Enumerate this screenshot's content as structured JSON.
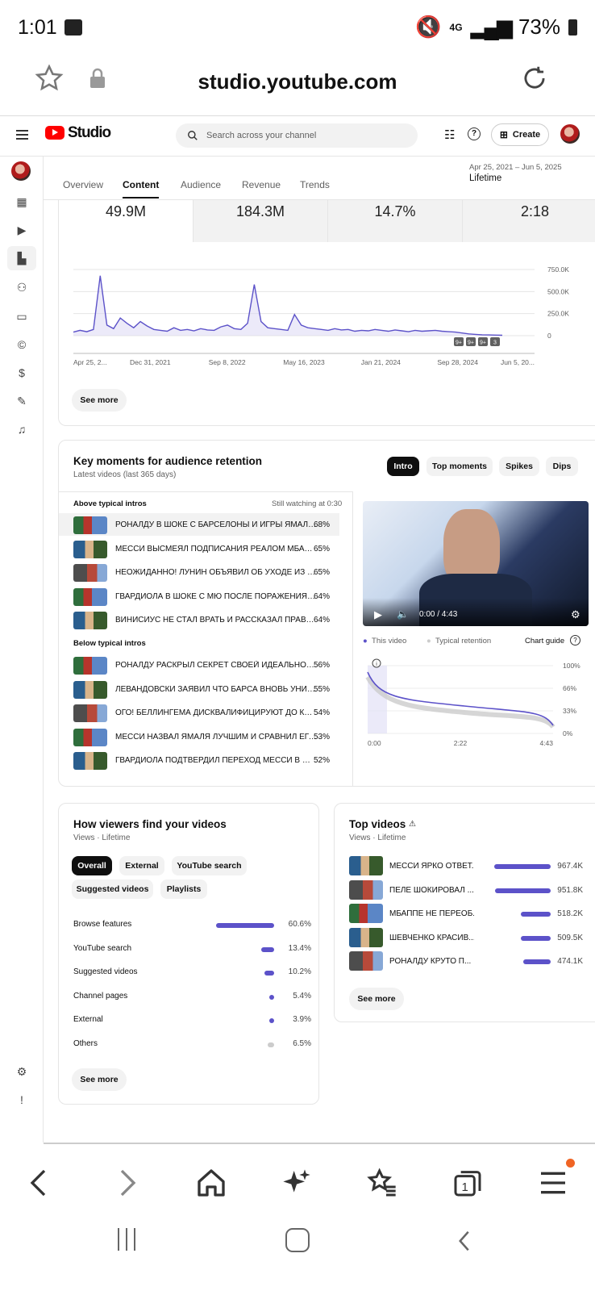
{
  "status": {
    "time": "1:01",
    "network": "4G",
    "battery": "73%"
  },
  "browser": {
    "url": "studio.youtube.com"
  },
  "studio": {
    "logo": "Studio",
    "search_placeholder": "Search across your channel",
    "create_label": "Create"
  },
  "tabs": [
    "Overview",
    "Content",
    "Audience",
    "Revenue",
    "Trends"
  ],
  "date_range": {
    "range": "Apr 25, 2021 – Jun 5, 2025",
    "label": "Lifetime"
  },
  "metrics": [
    "49.9M",
    "184.3M",
    "14.7%",
    "2:18"
  ],
  "chart_data": {
    "type": "line",
    "x_ticks": [
      "Apr 25, 2...",
      "Dec 31, 2021",
      "Sep 8, 2022",
      "May 16, 2023",
      "Jan 21, 2024",
      "Sep 28, 2024",
      "Jun 5, 20..."
    ],
    "y_ticks": [
      "750.0K",
      "500.0K",
      "250.0K",
      "0"
    ],
    "ylim": [
      0,
      750000
    ],
    "series": [
      {
        "values": [
          40000,
          60000,
          45000,
          70000,
          680000,
          120000,
          80000,
          200000,
          140000,
          90000,
          160000,
          110000,
          70000,
          60000,
          50000,
          90000,
          60000,
          70000,
          55000,
          80000,
          65000,
          60000,
          100000,
          120000,
          80000,
          70000,
          140000,
          580000,
          160000,
          90000,
          80000,
          70000,
          60000,
          240000,
          120000,
          90000,
          80000,
          70000,
          60000,
          80000,
          65000,
          70000,
          50000,
          60000,
          55000,
          70000,
          60000,
          50000,
          65000,
          55000,
          45000,
          60000,
          50000,
          55000,
          60000,
          50000,
          45000,
          40000,
          30000,
          20000,
          15000,
          10000,
          8000,
          6000,
          5000
        ]
      }
    ],
    "markers": [
      "9+",
      "9+",
      "9+",
      "3"
    ],
    "see_more": "See more"
  },
  "retention": {
    "title": "Key moments for audience retention",
    "subtitle": "Latest videos (last 365 days)",
    "chips": [
      "Intro",
      "Top moments",
      "Spikes",
      "Dips"
    ],
    "above_label": "Above typical intros",
    "still_watching": "Still watching at 0:30",
    "above": [
      {
        "title": "РОНАЛДУ В ШОКЕ С БАРСЕЛОНЫ И ИГРЫ ЯМАЛЯ В ...",
        "pct": "68%"
      },
      {
        "title": "МЕССИ ВЫСМЕЯЛ ПОДПИСАНИЯ РЕАЛОМ МБАППЕ ...",
        "pct": "65%"
      },
      {
        "title": "НЕОЖИДАННО! ЛУНИН ОБЪЯВИЛ ОБ УХОДЕ ИЗ РЕА...",
        "pct": "65%"
      },
      {
        "title": "ГВАРДИОЛА В ШОКЕ С МЮ ПОСЛЕ ПОРАЖЕНИЯ И РА...",
        "pct": "64%"
      },
      {
        "title": "ВИНИСИУС НЕ СТАЛ ВРАТЬ И РАССКАЗАЛ ПРАВДУ О...",
        "pct": "64%"
      }
    ],
    "below_label": "Below typical intros",
    "below": [
      {
        "title": "РОНАЛДУ РАСКРЫЛ СЕКРЕТ СВОЕЙ ИДЕАЛЬНОЙ Ф...",
        "pct": "56%"
      },
      {
        "title": "ЛЕВАНДОВСКИ ЗАЯВИЛ ЧТО БАРСА ВНОВЬ УНИЧТО...",
        "pct": "55%"
      },
      {
        "title": "ОГО! БЕЛЛИНГЕМА ДИСКВАЛИФИЦИРУЮТ ДО КОНЦ...",
        "pct": "54%"
      },
      {
        "title": "МЕССИ НАЗВАЛ ЯМАЛЯ ЛУЧШИМ И СРАВНИЛ ЕГО С ...",
        "pct": "53%"
      },
      {
        "title": "ГВАРДИОЛА ПОДТВЕРДИЛ ПЕРЕХОД МЕССИ В МАН ...",
        "pct": "52%"
      }
    ],
    "player_time": "0:00 / 4:43",
    "legend_this": "This video",
    "legend_typical": "Typical retention",
    "chart_guide": "Chart guide",
    "y_ticks": [
      "100%",
      "66%",
      "33%",
      "0%"
    ],
    "x_ticks": [
      "0:00",
      "2:22",
      "4:43"
    ]
  },
  "sources": {
    "title": "How viewers find your videos",
    "subtitle": "Views · Lifetime",
    "chips": [
      "Overall",
      "External",
      "YouTube search",
      "Suggested videos",
      "Playlists"
    ],
    "rows": [
      {
        "label": "Browse features",
        "pct": "60.6%",
        "value": 60.6
      },
      {
        "label": "YouTube search",
        "pct": "13.4%",
        "value": 13.4
      },
      {
        "label": "Suggested videos",
        "pct": "10.2%",
        "value": 10.2
      },
      {
        "label": "Channel pages",
        "pct": "5.4%",
        "value": 5.4
      },
      {
        "label": "External",
        "pct": "3.9%",
        "value": 3.9
      },
      {
        "label": "Others",
        "pct": "6.5%",
        "value": 6.5
      }
    ],
    "see_more": "See more"
  },
  "top_videos": {
    "title": "Top videos",
    "subtitle": "Views · Lifetime",
    "rows": [
      {
        "title": "МЕССИ ЯРКО ОТВЕТ...",
        "views": "967.4K",
        "value": 967.4
      },
      {
        "title": "ПЕЛЕ ШОКИРОВАЛ ...",
        "views": "951.8K",
        "value": 951.8
      },
      {
        "title": "МБАППЕ НЕ ПЕРЕОБ...",
        "views": "518.2K",
        "value": 518.2
      },
      {
        "title": "ШЕВЧЕНКО КРАСИВ...",
        "views": "509.5K",
        "value": 509.5
      },
      {
        "title": "РОНАЛДУ КРУТО П...",
        "views": "474.1K",
        "value": 474.1
      }
    ],
    "see_more": "See more"
  },
  "colors": {
    "accent": "#5c52c9",
    "brand_red": "#ff0000"
  }
}
